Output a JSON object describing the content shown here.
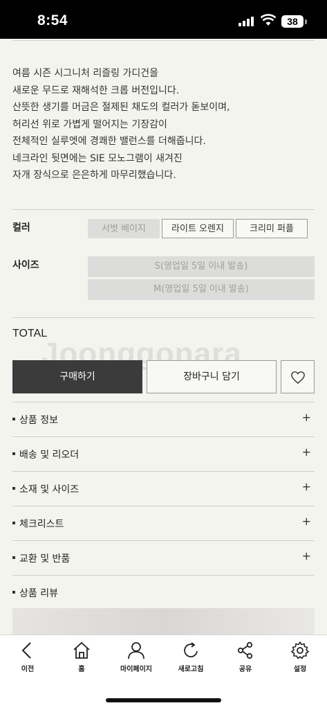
{
  "status_bar": {
    "time": "8:54",
    "battery": "38"
  },
  "description": [
    "여름 시즌 시그니처 리즐링 가디건을",
    "새로운 무드로 재해석한 크롭 버전입니다.",
    "산뜻한 생기를 머금은 절제된 채도의 컬러가 돋보이며,",
    "허리선 위로 가볍게 떨어지는 기장감이",
    "전체적인 실루엣에 경쾌한 밸런스를 더해줍니다.",
    "네크라인 뒷면에는 SIE 모노그램이 새겨진",
    "자개 장식으로 은은하게 마무리했습니다."
  ],
  "options": {
    "color_label": "컬러",
    "colors": [
      "서벗 베이지",
      "라이트 오렌지",
      "크리미 퍼플"
    ],
    "size_label": "사이즈",
    "sizes": [
      "S(영업일 5일 이내 발송)",
      "M(영업일 5일 이내 발송)"
    ]
  },
  "total_label": "TOTAL",
  "watermark": "Joonggonara",
  "actions": {
    "buy": "구매하기",
    "cart": "장바구니 담기"
  },
  "accordion": [
    {
      "label": "상품 정보",
      "plus": "+"
    },
    {
      "label": "배송 및 리오더",
      "plus": "+"
    },
    {
      "label": "소재 및 사이즈",
      "plus": "+"
    },
    {
      "label": "체크리스트",
      "plus": "+"
    },
    {
      "label": "교환 및 반품",
      "plus": "+"
    },
    {
      "label": "상품 리뷰",
      "plus": ""
    }
  ],
  "tabbar": {
    "back": "이전",
    "home": "홈",
    "mypage": "마이페이지",
    "refresh": "새로고침",
    "share": "공유",
    "settings": "설정"
  }
}
